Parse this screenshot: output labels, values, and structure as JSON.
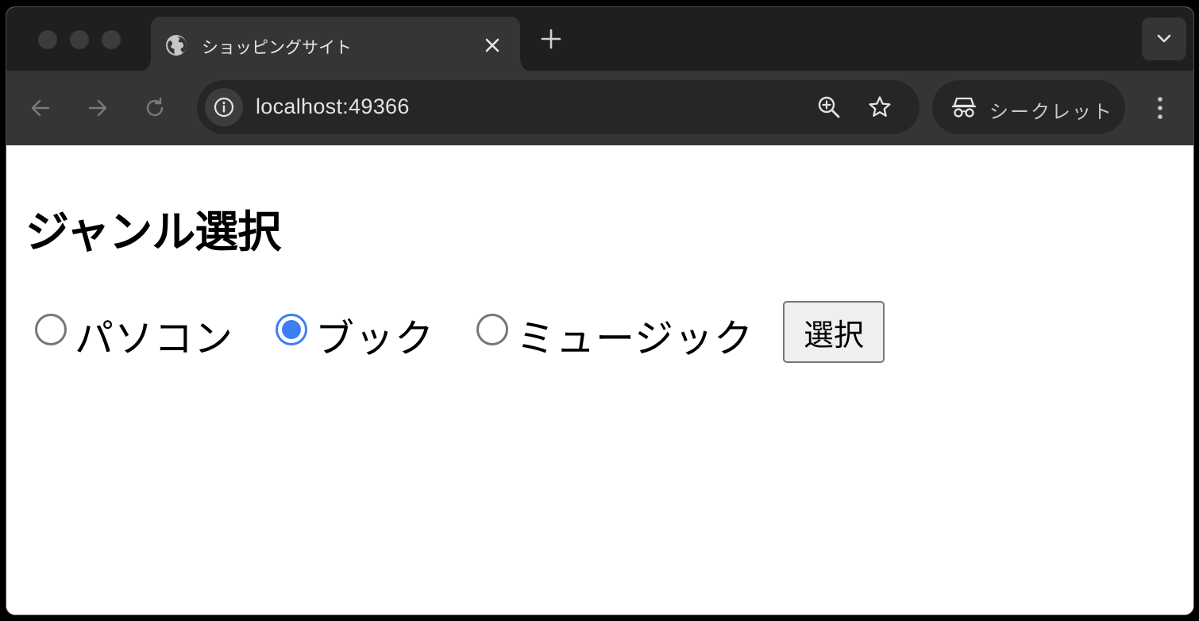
{
  "browser": {
    "tab": {
      "title": "ショッピングサイト",
      "favicon": "globe-icon"
    },
    "omnibox": {
      "url": "localhost:49366"
    },
    "incognito": {
      "label": "シークレット"
    },
    "colors": {
      "frame": "#1f1f1f",
      "toolbar": "#353535",
      "omnibox": "#262626"
    }
  },
  "page": {
    "heading": "ジャンル選択",
    "genre_options": [
      {
        "label": "パソコン",
        "checked": false
      },
      {
        "label": "ブック",
        "checked": true
      },
      {
        "label": "ミュージック",
        "checked": false
      }
    ],
    "submit_label": "選択",
    "accent_color": "#3b7ff2"
  }
}
